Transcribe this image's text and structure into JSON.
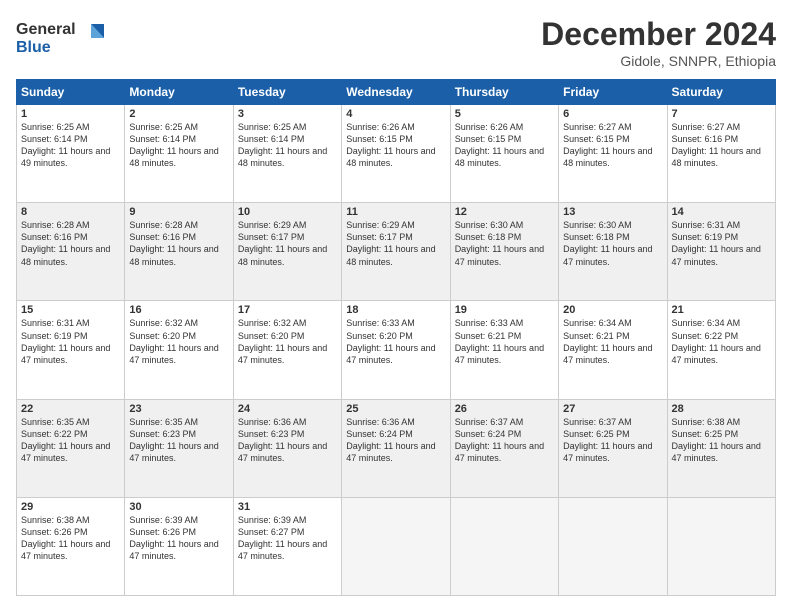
{
  "logo": {
    "line1": "General",
    "line2": "Blue"
  },
  "title": "December 2024",
  "location": "Gidole, SNNPR, Ethiopia",
  "weekdays": [
    "Sunday",
    "Monday",
    "Tuesday",
    "Wednesday",
    "Thursday",
    "Friday",
    "Saturday"
  ],
  "weeks": [
    [
      {
        "day": "1",
        "sunrise": "6:25 AM",
        "sunset": "6:14 PM",
        "daylight": "11 hours and 49 minutes."
      },
      {
        "day": "2",
        "sunrise": "6:25 AM",
        "sunset": "6:14 PM",
        "daylight": "11 hours and 48 minutes."
      },
      {
        "day": "3",
        "sunrise": "6:25 AM",
        "sunset": "6:14 PM",
        "daylight": "11 hours and 48 minutes."
      },
      {
        "day": "4",
        "sunrise": "6:26 AM",
        "sunset": "6:15 PM",
        "daylight": "11 hours and 48 minutes."
      },
      {
        "day": "5",
        "sunrise": "6:26 AM",
        "sunset": "6:15 PM",
        "daylight": "11 hours and 48 minutes."
      },
      {
        "day": "6",
        "sunrise": "6:27 AM",
        "sunset": "6:15 PM",
        "daylight": "11 hours and 48 minutes."
      },
      {
        "day": "7",
        "sunrise": "6:27 AM",
        "sunset": "6:16 PM",
        "daylight": "11 hours and 48 minutes."
      }
    ],
    [
      {
        "day": "8",
        "sunrise": "6:28 AM",
        "sunset": "6:16 PM",
        "daylight": "11 hours and 48 minutes."
      },
      {
        "day": "9",
        "sunrise": "6:28 AM",
        "sunset": "6:16 PM",
        "daylight": "11 hours and 48 minutes."
      },
      {
        "day": "10",
        "sunrise": "6:29 AM",
        "sunset": "6:17 PM",
        "daylight": "11 hours and 48 minutes."
      },
      {
        "day": "11",
        "sunrise": "6:29 AM",
        "sunset": "6:17 PM",
        "daylight": "11 hours and 48 minutes."
      },
      {
        "day": "12",
        "sunrise": "6:30 AM",
        "sunset": "6:18 PM",
        "daylight": "11 hours and 47 minutes."
      },
      {
        "day": "13",
        "sunrise": "6:30 AM",
        "sunset": "6:18 PM",
        "daylight": "11 hours and 47 minutes."
      },
      {
        "day": "14",
        "sunrise": "6:31 AM",
        "sunset": "6:19 PM",
        "daylight": "11 hours and 47 minutes."
      }
    ],
    [
      {
        "day": "15",
        "sunrise": "6:31 AM",
        "sunset": "6:19 PM",
        "daylight": "11 hours and 47 minutes."
      },
      {
        "day": "16",
        "sunrise": "6:32 AM",
        "sunset": "6:20 PM",
        "daylight": "11 hours and 47 minutes."
      },
      {
        "day": "17",
        "sunrise": "6:32 AM",
        "sunset": "6:20 PM",
        "daylight": "11 hours and 47 minutes."
      },
      {
        "day": "18",
        "sunrise": "6:33 AM",
        "sunset": "6:20 PM",
        "daylight": "11 hours and 47 minutes."
      },
      {
        "day": "19",
        "sunrise": "6:33 AM",
        "sunset": "6:21 PM",
        "daylight": "11 hours and 47 minutes."
      },
      {
        "day": "20",
        "sunrise": "6:34 AM",
        "sunset": "6:21 PM",
        "daylight": "11 hours and 47 minutes."
      },
      {
        "day": "21",
        "sunrise": "6:34 AM",
        "sunset": "6:22 PM",
        "daylight": "11 hours and 47 minutes."
      }
    ],
    [
      {
        "day": "22",
        "sunrise": "6:35 AM",
        "sunset": "6:22 PM",
        "daylight": "11 hours and 47 minutes."
      },
      {
        "day": "23",
        "sunrise": "6:35 AM",
        "sunset": "6:23 PM",
        "daylight": "11 hours and 47 minutes."
      },
      {
        "day": "24",
        "sunrise": "6:36 AM",
        "sunset": "6:23 PM",
        "daylight": "11 hours and 47 minutes."
      },
      {
        "day": "25",
        "sunrise": "6:36 AM",
        "sunset": "6:24 PM",
        "daylight": "11 hours and 47 minutes."
      },
      {
        "day": "26",
        "sunrise": "6:37 AM",
        "sunset": "6:24 PM",
        "daylight": "11 hours and 47 minutes."
      },
      {
        "day": "27",
        "sunrise": "6:37 AM",
        "sunset": "6:25 PM",
        "daylight": "11 hours and 47 minutes."
      },
      {
        "day": "28",
        "sunrise": "6:38 AM",
        "sunset": "6:25 PM",
        "daylight": "11 hours and 47 minutes."
      }
    ],
    [
      {
        "day": "29",
        "sunrise": "6:38 AM",
        "sunset": "6:26 PM",
        "daylight": "11 hours and 47 minutes."
      },
      {
        "day": "30",
        "sunrise": "6:39 AM",
        "sunset": "6:26 PM",
        "daylight": "11 hours and 47 minutes."
      },
      {
        "day": "31",
        "sunrise": "6:39 AM",
        "sunset": "6:27 PM",
        "daylight": "11 hours and 47 minutes."
      },
      null,
      null,
      null,
      null
    ]
  ]
}
